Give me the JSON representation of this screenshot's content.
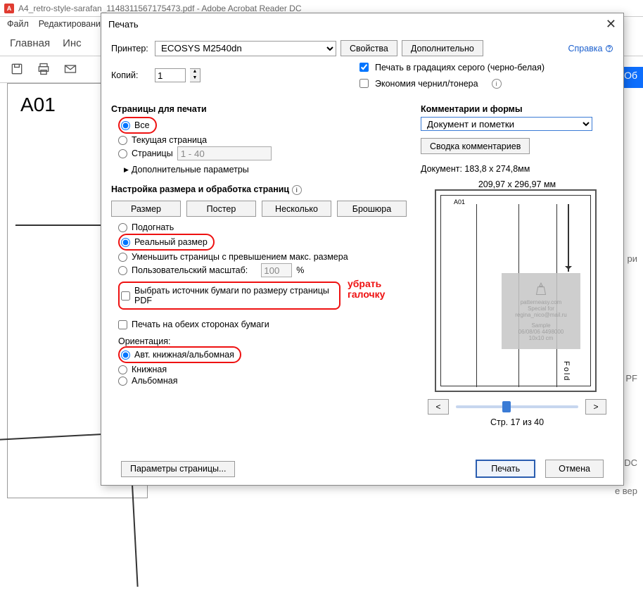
{
  "app": {
    "title": "A4_retro-style-sarafan_1148311567175473.pdf - Adobe Acrobat Reader DC",
    "menu": {
      "file": "Файл",
      "edit": "Редактирование"
    },
    "tabs": {
      "home": "Главная",
      "tools_partial": "Инс"
    },
    "doc_corner_label": "A01",
    "side_partial_1": "ри",
    "side_partial_2": "РF",
    "side_partial_3": "иру DC",
    "side_partial_4": "е вер",
    "blue_btn_partial": "Об"
  },
  "dialog": {
    "title": "Печать",
    "printer_label": "Принтер:",
    "printer_value": "ECOSYS M2540dn",
    "btn_props": "Свойства",
    "btn_advanced": "Дополнительно",
    "help": "Справка",
    "copies_label": "Копий:",
    "copies_value": "1",
    "chk_grayscale": "Печать в градациях серого (черно-белая)",
    "chk_saveink": "Экономия чернил/тонера",
    "pages": {
      "heading": "Страницы для печати",
      "all": "Все",
      "current": "Текущая страница",
      "range_label": "Страницы",
      "range_value": "1 - 40",
      "more": "Дополнительные параметры"
    },
    "sizing": {
      "heading": "Настройка размера и обработка страниц",
      "btn_size": "Размер",
      "btn_poster": "Постер",
      "btn_multiple": "Несколько",
      "btn_booklet": "Брошюра",
      "fit": "Подогнать",
      "actual": "Реальный размер",
      "shrink": "Уменьшить страницы с превышением макс. размера",
      "custom_scale": "Пользовательский масштаб:",
      "custom_scale_val": "100",
      "pct": "%",
      "choose_source": "Выбрать источник бумаги по размеру страницы PDF",
      "duplex": "Печать на обеих сторонах бумаги",
      "orient_label": "Ориентация:",
      "orient_auto": "Авт. книжная/альбомная",
      "orient_portrait": "Книжная",
      "orient_landscape": "Альбомная"
    },
    "comments": {
      "heading": "Комментарии и формы",
      "select_value": "Документ и пометки",
      "btn_summary": "Сводка комментариев",
      "doc_size": "Документ: 183,8 x 274,8мм",
      "sheet_size": "209,97 x 296,97 мм"
    },
    "preview": {
      "corner": "A01",
      "fold": "Fold",
      "wm1": "patterneasy.com",
      "wm2": "Special for",
      "wm3": "regina_nico@mail.ru",
      "wm4": "Sample",
      "wm5": "06/08/06 4498000",
      "wm6": "10x10 cm",
      "prev": "<",
      "next": ">",
      "page_of": "Стр. 17 из 40"
    },
    "annotation": {
      "line1": "убрать",
      "line2": "галочку"
    },
    "footer": {
      "page_setup": "Параметры страницы...",
      "print": "Печать",
      "cancel": "Отмена"
    }
  }
}
